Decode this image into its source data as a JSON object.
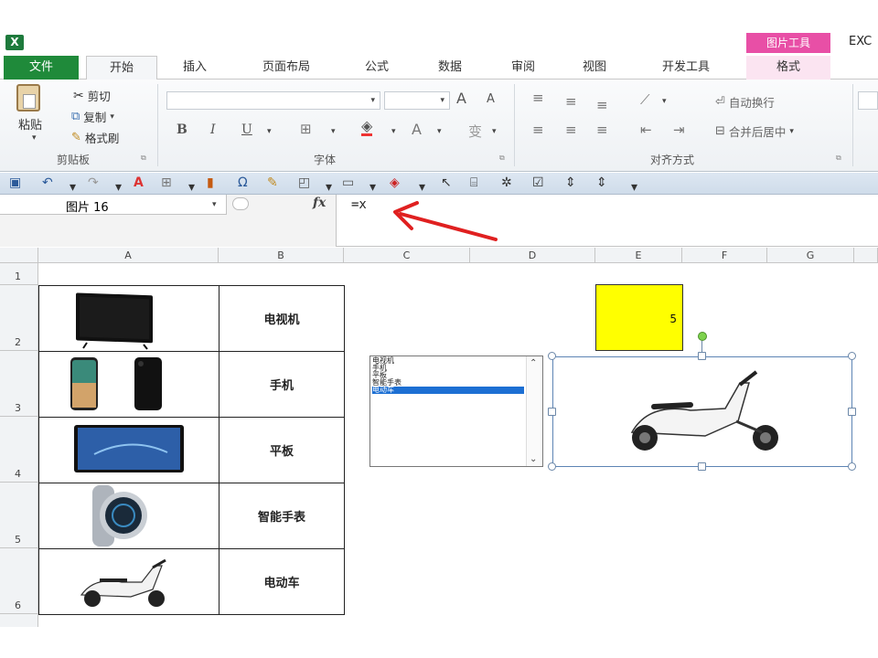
{
  "app": {
    "title_fragment": "EXC",
    "context_tab_group": "图片工具"
  },
  "tabs": [
    {
      "label": "文件"
    },
    {
      "label": "开始"
    },
    {
      "label": "插入"
    },
    {
      "label": "页面布局"
    },
    {
      "label": "公式"
    },
    {
      "label": "数据"
    },
    {
      "label": "审阅"
    },
    {
      "label": "视图"
    },
    {
      "label": "开发工具"
    },
    {
      "label": "格式"
    }
  ],
  "ribbon": {
    "clipboard": {
      "paste": "粘贴",
      "cut": "剪切",
      "copy": "复制",
      "format_painter": "格式刷",
      "group_label": "剪贴板"
    },
    "font": {
      "group_label": "字体",
      "bold": "B",
      "italic": "I",
      "underline": "U",
      "grow": "A",
      "shrink": "A",
      "font_color": "A",
      "phonetic": "变"
    },
    "alignment": {
      "wrap_text": "自动换行",
      "merge_center": "合并后居中",
      "group_label": "对齐方式"
    }
  },
  "formula_bar": {
    "name_box": "图片 16",
    "fx": "fx",
    "formula": "=x"
  },
  "columns": [
    "A",
    "B",
    "C",
    "D",
    "E",
    "F",
    "G"
  ],
  "rows": [
    "1",
    "2",
    "3",
    "4",
    "5",
    "6"
  ],
  "products": [
    {
      "name": "电视机",
      "icon": "tv-image"
    },
    {
      "name": "手机",
      "icon": "phone-image"
    },
    {
      "name": "平板",
      "icon": "tablet-image"
    },
    {
      "name": "智能手表",
      "icon": "watch-image"
    },
    {
      "name": "电动车",
      "icon": "scooter-image"
    }
  ],
  "listbox": {
    "items": [
      "电视机",
      "手机",
      "平板",
      "智能手表",
      "电动车"
    ],
    "selected_index": 4
  },
  "linked_cell_value": "5",
  "colors": {
    "file_tab": "#1f8a3a",
    "context_tab": "#e84fa6",
    "selection": "#1c6fd3",
    "highlight": "#ffff00",
    "arrow": "#e02020"
  }
}
